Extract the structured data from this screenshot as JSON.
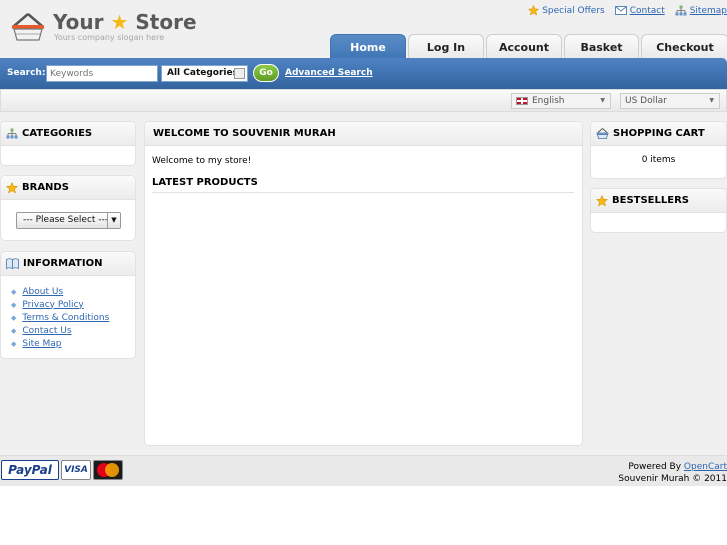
{
  "header": {
    "logo_text_left": "Your",
    "logo_text_right": "Store",
    "slogan": "Yours company slogan here",
    "top_links": [
      {
        "label": "Special Offers",
        "icon": "star-icon"
      },
      {
        "label": "Contact",
        "icon": "mail-icon"
      },
      {
        "label": "Sitemap",
        "icon": "sitemap-icon"
      }
    ],
    "tabs": [
      {
        "label": "Home",
        "active": true
      },
      {
        "label": "Log In",
        "active": false
      },
      {
        "label": "Account",
        "active": false
      },
      {
        "label": "Basket",
        "active": false
      },
      {
        "label": "Checkout",
        "active": false
      }
    ]
  },
  "search": {
    "label": "Search:",
    "placeholder": "Keywords",
    "category": "All Categories",
    "go_label": "Go",
    "advanced_label": "Advanced Search"
  },
  "selectors": {
    "language": "English",
    "currency": "US Dollar"
  },
  "left": {
    "categories_title": "CATEGORIES",
    "brands_title": "BRANDS",
    "brands_select": "--- Please Select ---",
    "information_title": "INFORMATION",
    "information_links": [
      "About Us",
      "Privacy Policy",
      "Terms & Conditions",
      "Contact Us",
      "Site Map"
    ]
  },
  "main": {
    "title": "WELCOME TO SOUVENIR MURAH",
    "welcome_text": "Welcome to my store!",
    "latest_title": "LATEST PRODUCTS"
  },
  "right": {
    "cart_title": "SHOPPING CART",
    "cart_text": "0 items",
    "bestsellers_title": "BESTSELLERS"
  },
  "footer": {
    "payment_cards": [
      "PayPal",
      "VISA",
      "MasterCard"
    ],
    "powered_prefix": "Powered By",
    "powered_link": "OpenCart",
    "copyright": "Souvenir Murah © 2011"
  },
  "colors": {
    "accent_blue": "#3f74b5",
    "link_blue": "#2d67b2",
    "go_green": "#6aab2b"
  }
}
